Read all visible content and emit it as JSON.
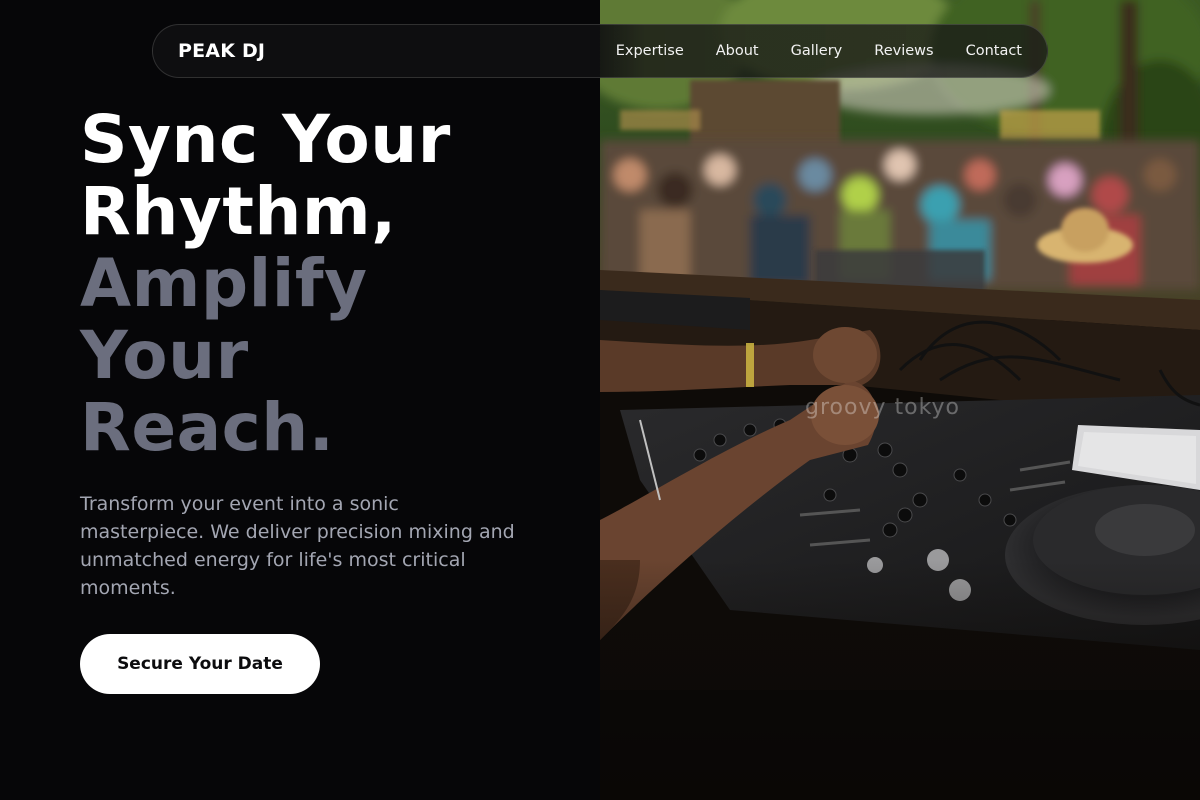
{
  "brand": {
    "logo_text": "PEAK DJ"
  },
  "nav": {
    "links": [
      {
        "label": "Expertise"
      },
      {
        "label": "About"
      },
      {
        "label": "Gallery"
      },
      {
        "label": "Reviews"
      },
      {
        "label": "Contact"
      }
    ]
  },
  "hero": {
    "headline_lines": [
      "Sync Your",
      "Rhythm,",
      "Amplify",
      "Your",
      "Reach."
    ],
    "subtext": "Transform your event into a sonic masterpiece. We deliver precision mixing and unmatched energy for life's most critical moments.",
    "cta_label": "Secure Your Date",
    "image_watermark": "groovy tokyo"
  },
  "colors": {
    "background": "#060608",
    "headline_primary": "#ffffff",
    "headline_muted": "#6b6e7e",
    "subtext": "#a3a6b2",
    "cta_background": "#ffffff",
    "cta_text": "#0c0c0e"
  },
  "icons": {
    "hero_image": "dj-mixing-at-outdoor-festival-photo"
  }
}
